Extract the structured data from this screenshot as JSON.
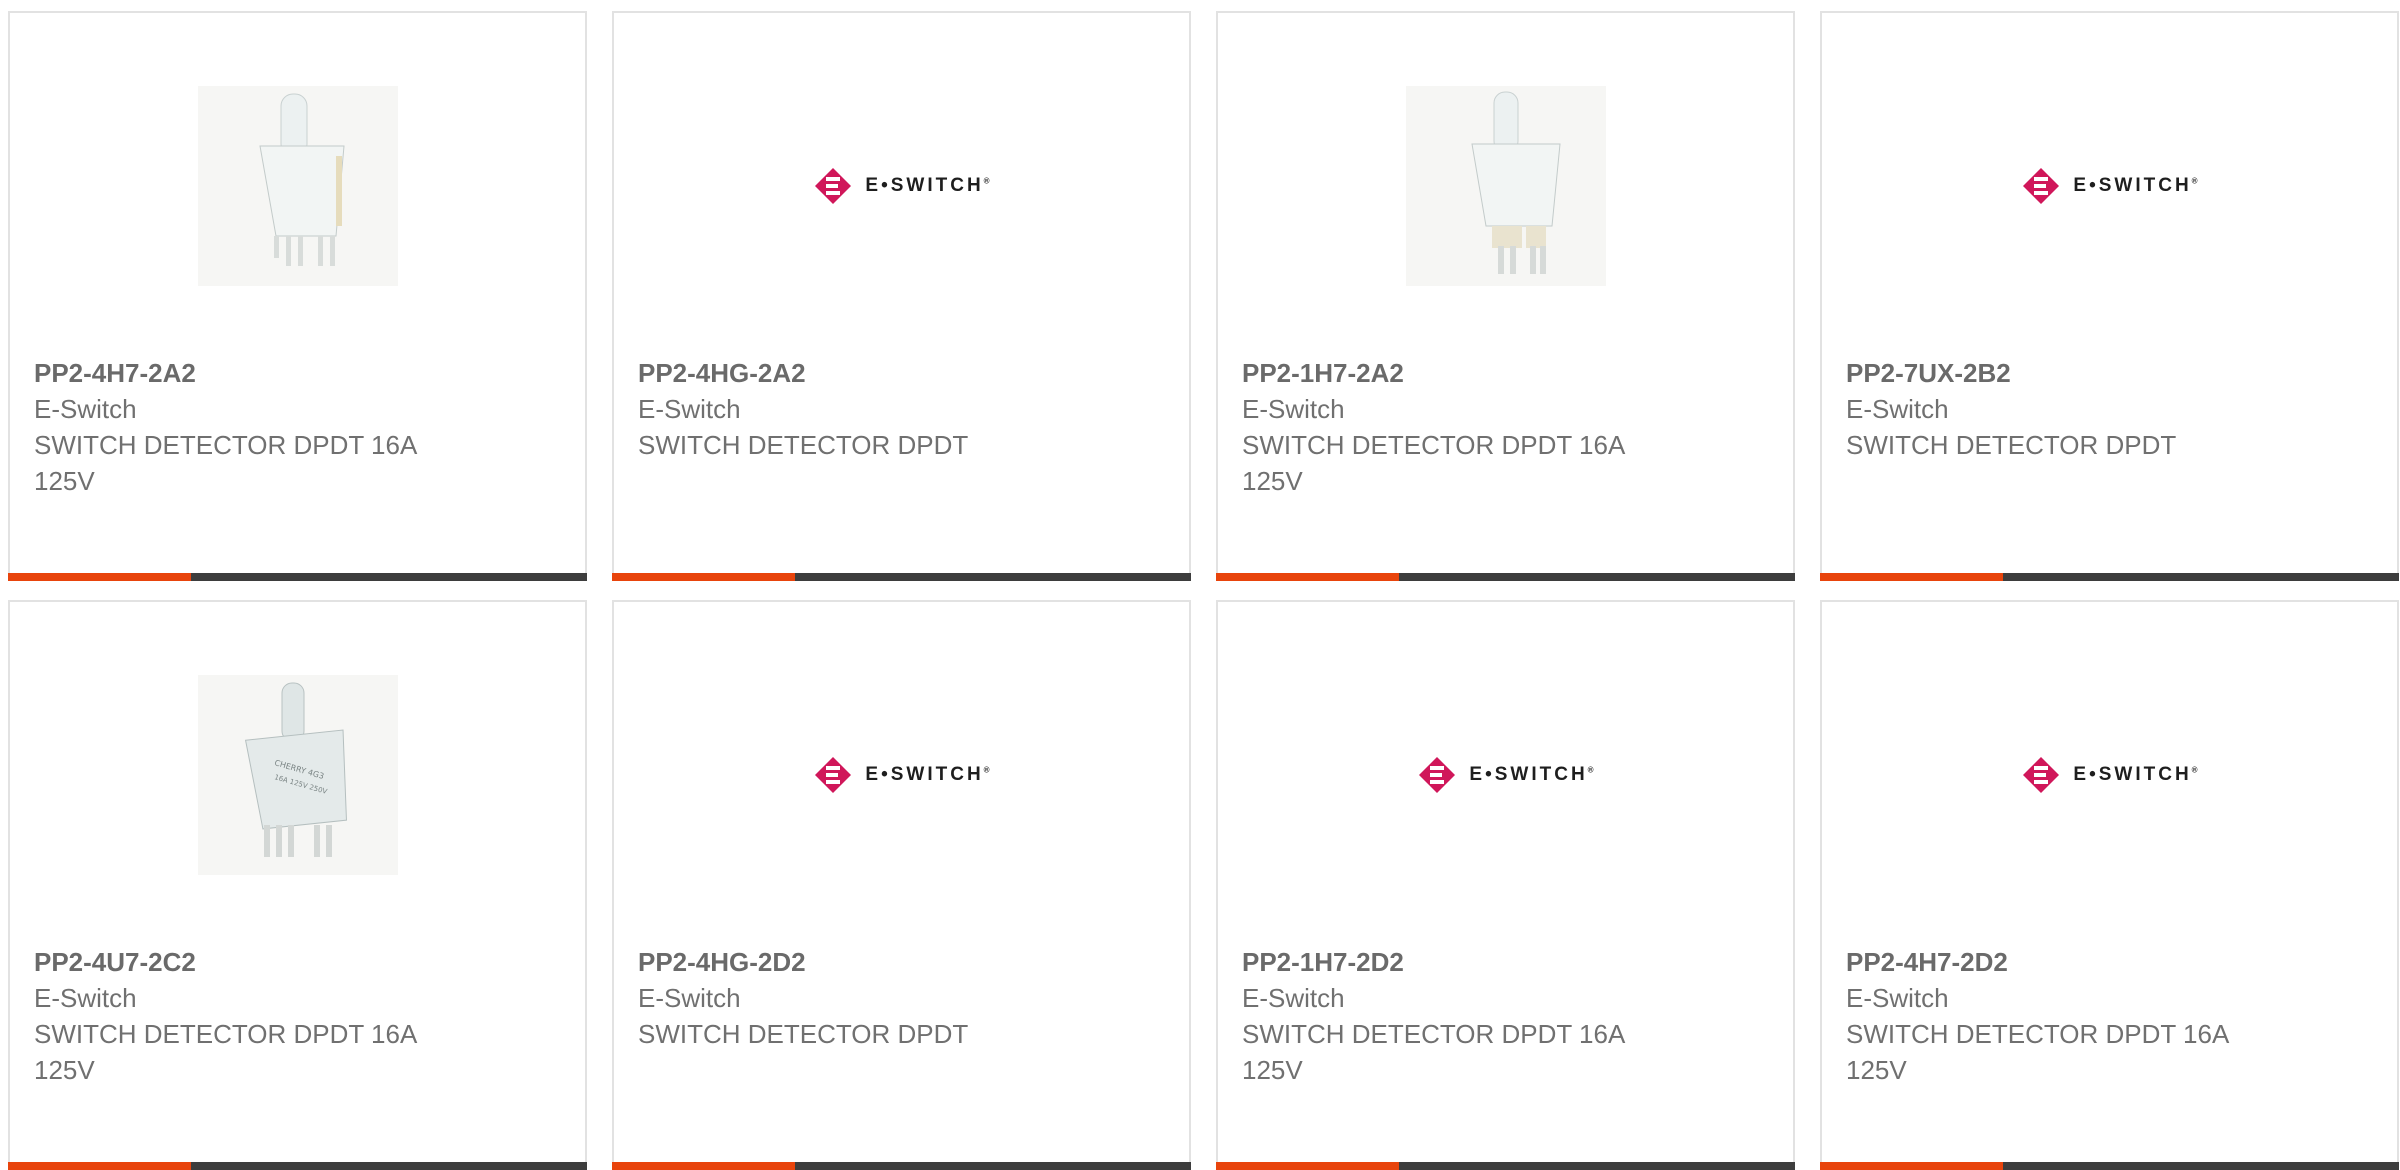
{
  "products": [
    {
      "part_number": "PP2-4H7-2A2",
      "manufacturer": "E-Switch",
      "description": "SWITCH DETECTOR DPDT 16A 125V",
      "image": "switch-photo-a"
    },
    {
      "part_number": "PP2-4HG-2A2",
      "manufacturer": "E-Switch",
      "description": "SWITCH DETECTOR DPDT",
      "image": "eswitch-logo"
    },
    {
      "part_number": "PP2-1H7-2A2",
      "manufacturer": "E-Switch",
      "description": "SWITCH DETECTOR DPDT 16A 125V",
      "image": "switch-photo-b"
    },
    {
      "part_number": "PP2-7UX-2B2",
      "manufacturer": "E-Switch",
      "description": "SWITCH DETECTOR DPDT",
      "image": "eswitch-logo"
    },
    {
      "part_number": "PP2-4U7-2C2",
      "manufacturer": "E-Switch",
      "description": "SWITCH DETECTOR DPDT 16A 125V",
      "image": "switch-photo-c"
    },
    {
      "part_number": "PP2-4HG-2D2",
      "manufacturer": "E-Switch",
      "description": "SWITCH DETECTOR DPDT",
      "image": "eswitch-logo"
    },
    {
      "part_number": "PP2-1H7-2D2",
      "manufacturer": "E-Switch",
      "description": "SWITCH DETECTOR DPDT 16A 125V",
      "image": "eswitch-logo"
    },
    {
      "part_number": "PP2-4H7-2D2",
      "manufacturer": "E-Switch",
      "description": "SWITCH DETECTOR DPDT 16A 125V",
      "image": "eswitch-logo"
    }
  ],
  "logo": {
    "text": "E•SWITCH",
    "mark": "®"
  },
  "colors": {
    "accent_orange": "#e8440c",
    "accent_dark": "#3d3d3d",
    "logo_magenta": "#d0175a",
    "text_gray": "#707070",
    "card_border": "#e2e2e2"
  }
}
